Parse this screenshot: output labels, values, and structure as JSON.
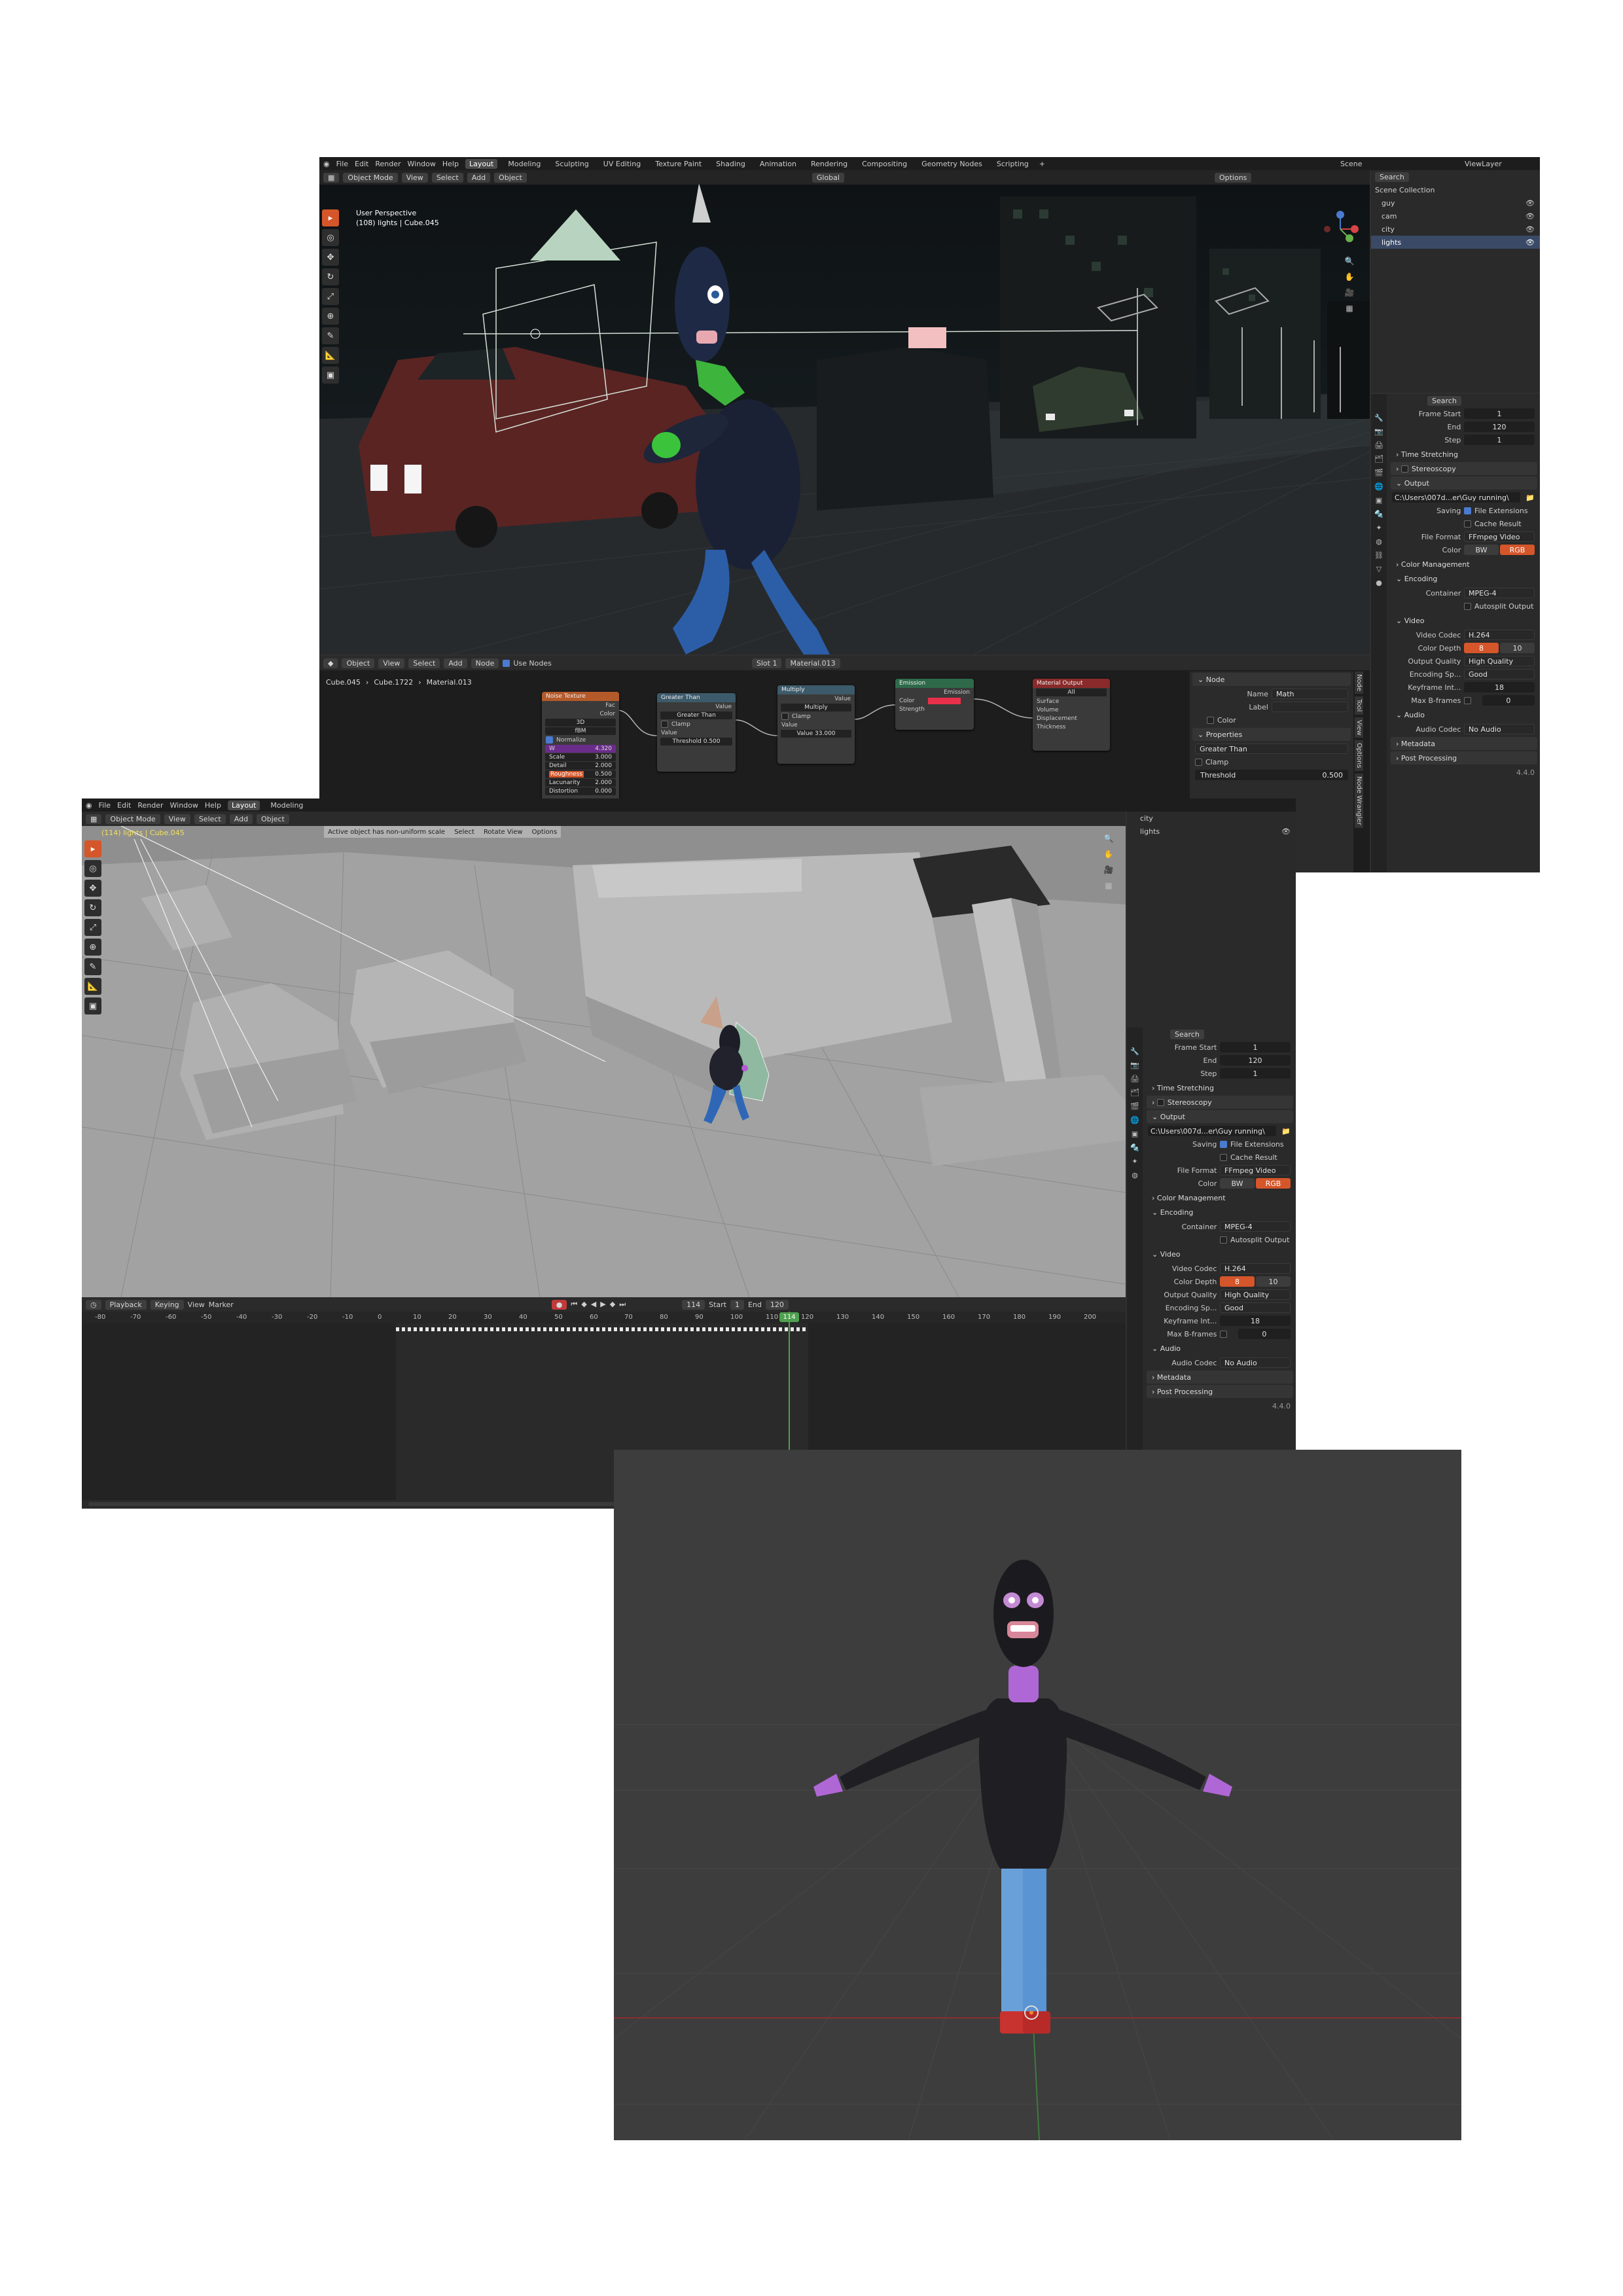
{
  "shot1": {
    "menu": [
      "File",
      "Edit",
      "Render",
      "Window",
      "Help"
    ],
    "workspaces": [
      "Layout",
      "Modeling",
      "Sculpting",
      "UV Editing",
      "Texture Paint",
      "Shading",
      "Animation",
      "Rendering",
      "Compositing",
      "Geometry Nodes",
      "Scripting"
    ],
    "active_workspace": "Layout",
    "scene_label": "Scene",
    "viewlayer_label": "ViewLayer",
    "mode": "Object Mode",
    "view_menu": [
      "View",
      "Select",
      "Add",
      "Object"
    ],
    "transform_orient": "Global",
    "options_label": "Options",
    "viewport_overlay": [
      "User Perspective",
      "(108) lights | Cube.045"
    ],
    "outliner": {
      "search": "Search",
      "title": "Scene Collection",
      "items": [
        "guy",
        "cam",
        "city",
        "lights"
      ]
    },
    "node_editor": {
      "header": [
        "Object",
        "View",
        "Select",
        "Add",
        "Node"
      ],
      "use_nodes": "Use Nodes",
      "slot": "Slot 1",
      "material": "Material.013",
      "breadcrumb": [
        "Cube.045",
        "Cube.1722",
        "Material.013"
      ],
      "noise": {
        "title": "Noise Texture",
        "out1": "Fac",
        "out2": "Color",
        "dim": "3D",
        "type": "fBM",
        "normalize": "Normalize",
        "w_label": "W",
        "w_val": "4.320",
        "scale_label": "Scale",
        "scale_val": "3.000",
        "detail_label": "Detail",
        "detail_val": "2.000",
        "rough_label": "Roughness",
        "rough_val": "0.500",
        "lac_label": "Lacunarity",
        "lac_val": "2.000",
        "dist_label": "Distortion",
        "dist_val": "0.000"
      },
      "greater": {
        "title": "Greater Than",
        "out": "Value",
        "op": "Greater Than",
        "clamp": "Clamp",
        "in": "Value",
        "thr_label": "Threshold",
        "thr_val": "0.500"
      },
      "multiply": {
        "title": "Multiply",
        "out": "Value",
        "op": "Multiply",
        "clamp": "Clamp",
        "in": "Value",
        "val_label": "Value",
        "val_val": "33.000"
      },
      "emission": {
        "title": "Emission",
        "out": "Emission",
        "color": "Color",
        "strength": "Strength"
      },
      "output": {
        "title": "Material Output",
        "target": "All",
        "surface": "Surface",
        "volume": "Volume",
        "disp": "Displacement",
        "thick": "Thickness"
      },
      "side": {
        "node_title": "Node",
        "name_label": "Name",
        "name_val": "Math",
        "label_label": "Label",
        "color_label": "Color",
        "props_title": "Properties",
        "op": "Greater Than",
        "clamp": "Clamp",
        "thr_label": "Threshold",
        "thr_val": "0.500"
      },
      "tabs": [
        "Node",
        "Tool",
        "View",
        "Options",
        "Node Wrangler"
      ]
    },
    "props": {
      "search": "Search",
      "frame_start_label": "Frame Start",
      "frame_start": "1",
      "end_label": "End",
      "end": "120",
      "step_label": "Step",
      "step": "1",
      "time_stretching": "Time Stretching",
      "stereoscopy": "Stereoscopy",
      "output": "Output",
      "path": "C:\\Users\\007d...er\\Guy running\\",
      "saving_label": "Saving",
      "file_ext": "File Extensions",
      "cache": "Cache Result",
      "file_format_label": "File Format",
      "file_format": "FFmpeg Video",
      "color_label": "Color",
      "bw": "BW",
      "rgb": "RGB",
      "color_mgmt": "Color Management",
      "encoding": "Encoding",
      "container_label": "Container",
      "container": "MPEG-4",
      "autosplit": "Autosplit Output",
      "video": "Video",
      "codec_label": "Video Codec",
      "codec": "H.264",
      "depth_label": "Color Depth",
      "depth_a": "8",
      "depth_b": "10",
      "quality_label": "Output Quality",
      "quality": "High Quality",
      "speed_label": "Encoding Sp...",
      "speed": "Good",
      "keyframe_label": "Keyframe Int...",
      "keyframe": "18",
      "bframes_label": "Max B-frames",
      "bframes": "0",
      "audio": "Audio",
      "acodec_label": "Audio Codec",
      "acodec": "No Audio",
      "metadata": "Metadata",
      "post": "Post Processing",
      "version": "4.4.0"
    }
  },
  "shot2": {
    "menu": [
      "File",
      "Edit",
      "Render",
      "Window",
      "Help"
    ],
    "workspaces": [
      "Layout",
      "Modeling"
    ],
    "mode": "Object Mode",
    "view_menu": [
      "View",
      "Select",
      "Add",
      "Object"
    ],
    "overlay_text": "(114) lights | Cube.045",
    "status": [
      "Active object has non-uniform scale",
      "Select",
      "Rotate View",
      "Options"
    ],
    "outliner_items": [
      "city",
      "lights"
    ],
    "timeline": {
      "menus": [
        "Playback",
        "Keying",
        "View",
        "Marker"
      ],
      "current": "114",
      "start_label": "Start",
      "start": "1",
      "end_label": "End",
      "end": "120",
      "ticks": [
        "-80",
        "-70",
        "-60",
        "-50",
        "-40",
        "-30",
        "-20",
        "-10",
        "0",
        "10",
        "20",
        "30",
        "40",
        "50",
        "60",
        "70",
        "80",
        "90",
        "100",
        "110",
        "120",
        "130",
        "140",
        "150",
        "160",
        "170",
        "180",
        "190",
        "200"
      ]
    },
    "props": {
      "search": "Search",
      "frame_start_label": "Frame Start",
      "frame_start": "1",
      "end_label": "End",
      "end": "120",
      "step_label": "Step",
      "step": "1",
      "time_stretching": "Time Stretching",
      "stereoscopy": "Stereoscopy",
      "output": "Output",
      "path": "C:\\Users\\007d...er\\Guy running\\",
      "saving_label": "Saving",
      "file_ext": "File Extensions",
      "cache": "Cache Result",
      "file_format_label": "File Format",
      "file_format": "FFmpeg Video",
      "color_label": "Color",
      "bw": "BW",
      "rgb": "RGB",
      "color_mgmt": "Color Management",
      "encoding": "Encoding",
      "container_label": "Container",
      "container": "MPEG-4",
      "autosplit": "Autosplit Output",
      "video": "Video",
      "codec_label": "Video Codec",
      "codec": "H.264",
      "depth_label": "Color Depth",
      "depth_a": "8",
      "depth_b": "10",
      "quality_label": "Output Quality",
      "quality": "High Quality",
      "speed_label": "Encoding Sp...",
      "speed": "Good",
      "keyframe_label": "Keyframe Int...",
      "keyframe": "18",
      "bframes_label": "Max B-frames",
      "bframes": "0",
      "audio": "Audio",
      "acodec_label": "Audio Codec",
      "acodec": "No Audio",
      "metadata": "Metadata",
      "post": "Post Processing",
      "version": "4.4.0"
    }
  },
  "colors": {
    "accent": "#d5562a",
    "emission": "#e8304a",
    "keyframe": "#e0c35a",
    "playhead": "#4fa04f"
  }
}
